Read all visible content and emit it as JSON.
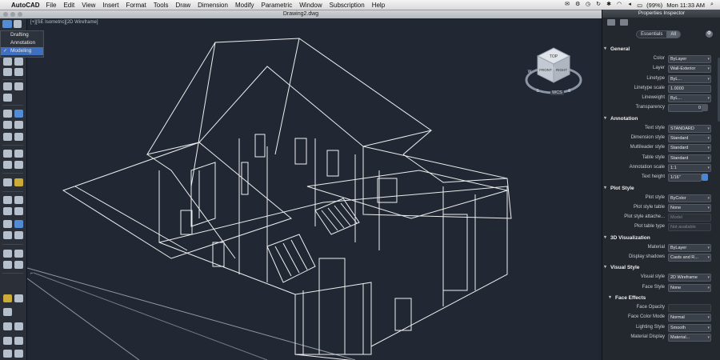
{
  "menubar": {
    "app_name": "AutoCAD",
    "menus": [
      "File",
      "Edit",
      "View",
      "Insert",
      "Format",
      "Tools",
      "Draw",
      "Dimension",
      "Modify",
      "Parametric",
      "Window",
      "Subscription",
      "Help"
    ],
    "battery": "(99%)",
    "clock": "Mon 11:33 AM"
  },
  "window": {
    "title": "Drawing2.dwg"
  },
  "viewport": {
    "label": "[+][SE Isometric][2D Wireframe]",
    "viewcube": {
      "top": "TOP",
      "front": "FRONT",
      "right": "RIGHT",
      "n": "N",
      "s": "S",
      "e": "E",
      "w": "W"
    },
    "wcs_label": "WCS"
  },
  "workspace_menu": {
    "items": [
      "Drafting",
      "Annotation",
      "Modeling"
    ],
    "selected": "Modeling"
  },
  "inspector": {
    "title": "Properties Inspector",
    "tabs": [
      "Essentials",
      "All"
    ],
    "active_tab": "All",
    "sections": {
      "general": {
        "title": "General",
        "rows": [
          {
            "label": "Color",
            "value": "ByLayer"
          },
          {
            "label": "Layer",
            "value": "Wall-Exterior"
          },
          {
            "label": "Linetype",
            "value": "ByL..."
          },
          {
            "label": "Linetype scale",
            "value": "1.0000"
          },
          {
            "label": "Lineweight",
            "value": "ByL..."
          },
          {
            "label": "Transparency",
            "value": "0"
          }
        ]
      },
      "annotation": {
        "title": "Annotation",
        "rows": [
          {
            "label": "Text style",
            "value": "STANDARD"
          },
          {
            "label": "Dimension style",
            "value": "Standard"
          },
          {
            "label": "Multileader style",
            "value": "Standard"
          },
          {
            "label": "Table style",
            "value": "Standard"
          },
          {
            "label": "Annotation scale",
            "value": "1:1"
          },
          {
            "label": "Text height",
            "value": "1/16\""
          }
        ]
      },
      "plot_style": {
        "title": "Plot Style",
        "rows": [
          {
            "label": "Plot style",
            "value": "ByColor"
          },
          {
            "label": "Plot style table",
            "value": "None"
          },
          {
            "label": "Plot style attache...",
            "value": "Model"
          },
          {
            "label": "Plot table type",
            "value": "Not available"
          }
        ]
      },
      "viz3d": {
        "title": "3D Visualization",
        "rows": [
          {
            "label": "Material",
            "value": "ByLayer"
          },
          {
            "label": "Display shadows",
            "value": "Casts and R..."
          }
        ]
      },
      "visual_style": {
        "title": "Visual Style",
        "rows": [
          {
            "label": "Visual style",
            "value": "2D Wireframe"
          },
          {
            "label": "Face Style",
            "value": "None"
          }
        ]
      },
      "face_effects": {
        "title": "Face Effects",
        "rows": [
          {
            "label": "Face Opacity",
            "value": ""
          },
          {
            "label": "Face Color Mode",
            "value": "Normal"
          },
          {
            "label": "Lighting Style",
            "value": "Smooth"
          },
          {
            "label": "Material Display",
            "value": "Material..."
          }
        ]
      }
    }
  }
}
